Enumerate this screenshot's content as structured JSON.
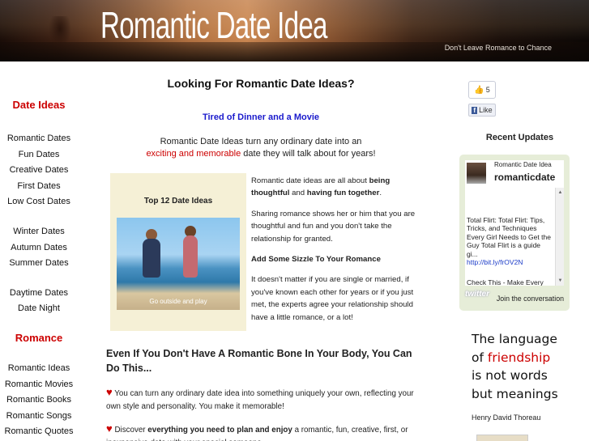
{
  "header": {
    "title": "Romantic Date Idea",
    "tagline": "Don't Leave Romance to Chance"
  },
  "leftnav": {
    "heading1": "Date Ideas",
    "group1": [
      "Romantic Dates",
      "Fun Dates",
      "Creative Dates",
      "First Dates",
      "Low Cost Dates"
    ],
    "group2": [
      "Winter Dates",
      "Autumn Dates",
      "Summer Dates"
    ],
    "group3": [
      "Daytime Dates",
      "Date Night"
    ],
    "heading2": "Romance",
    "group4": [
      "Romantic Ideas",
      "Romantic Movies",
      "Romantic Books",
      "Romantic Songs",
      "Romantic Quotes"
    ]
  },
  "main": {
    "title": "Looking For Romantic Date Ideas?",
    "subtitle": "Tired of Dinner and a Movie",
    "intro_line1": "Romantic Date Ideas turn any ordinary date into an",
    "intro_red": "exciting and memorable",
    "intro_line2_rest": " date they will talk about for years!",
    "photo_box": {
      "title": "Top 12 Date Ideas",
      "caption": "Go outside and play"
    },
    "side": {
      "p1_a": "Romantic date ideas are all about ",
      "p1_b": "being thoughtful",
      "p1_c": " and ",
      "p1_d": "having fun together",
      "p1_e": ".",
      "p2": "Sharing romance shows her or him that you are thoughtful and fun and you don't take the relationship for granted.",
      "p3": "Add Some Sizzle To Your Romance",
      "p4": "It doesn't matter if you are single or married, if you've known each other for years or if you just met, the experts agree your relationship should have a little romance, or a lot!"
    },
    "h2": "Even If You Don't Have A Romantic Bone In Your Body, You Can Do This...",
    "bullet1": "You can turn any ordinary date idea into something uniquely your own, reflecting your own style and personality. You make it memorable!",
    "bullet2_a": "Discover ",
    "bullet2_b": "everything you need to plan and enjoy",
    "bullet2_c": " a romantic, fun, creative, first, or inexpensive date with your special someone.",
    "heart": "♥"
  },
  "right": {
    "like_count": "5",
    "like_label": "Like",
    "recent_title": "Recent Updates",
    "twitter": {
      "display_name": "Romantic Date Idea",
      "username": "romanticdate",
      "tweet": "Total Flirt: Total Flirt: Tips, Tricks, and Techniques Every Girl Needs to Get the Guy Total Flirt is a guide gi...",
      "tweet_link": "http://bit.ly/frOV2N",
      "tweet2": "Check This - Make Every",
      "logo": "twitter",
      "join": "Join the conversation"
    },
    "quote": {
      "line1": "The language",
      "line2_a": "of ",
      "line2_b": "friendship",
      "line3": "is not words",
      "line4": "but meanings",
      "author": "Henry David Thoreau"
    }
  }
}
